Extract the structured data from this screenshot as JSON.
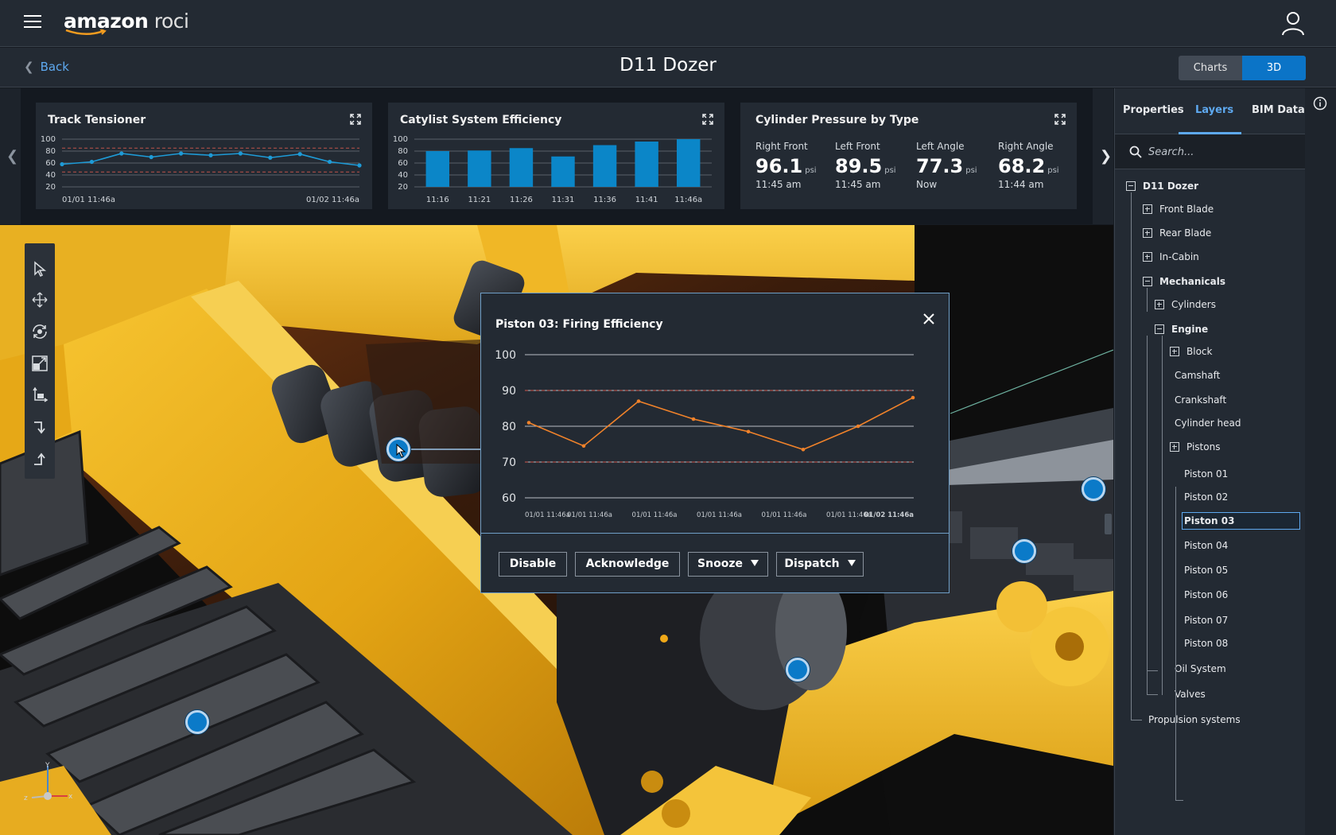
{
  "header": {
    "logo_bold": "amazon",
    "logo_thin": "roci",
    "back_label": "Back",
    "title": "D11 Dozer",
    "view_toggle": [
      "Charts",
      "3D view"
    ],
    "active_view": "3D view"
  },
  "cards": {
    "track_tensioner": {
      "title": "Track Tensioner",
      "chart_data": {
        "type": "line",
        "y_ticks": [
          100,
          80,
          60,
          40,
          20
        ],
        "ylim": [
          20,
          100
        ],
        "x_labels": [
          "01/01 11:46a",
          "01/02 11:46a"
        ],
        "values": [
          58,
          62,
          76,
          70,
          76,
          73,
          76,
          69,
          75,
          62,
          56
        ],
        "thresholds": [
          85,
          45
        ],
        "colors": {
          "line": "#1e9bd7",
          "threshold": "#c0524a",
          "grid": "#58606a"
        }
      }
    },
    "catalyst": {
      "title": "Catylist System Efficiency",
      "chart_data": {
        "type": "bar",
        "categories": [
          "11:16",
          "11:21",
          "11:26",
          "11:31",
          "11:36",
          "11:41",
          "11:46a"
        ],
        "values": [
          80,
          81,
          85,
          71,
          90,
          96,
          100
        ],
        "y_ticks": [
          100,
          80,
          60,
          40,
          20
        ],
        "ylim": [
          20,
          100
        ],
        "colors": {
          "bar": "#0b86c8",
          "grid": "#58606a"
        }
      }
    },
    "cylinder_pressure": {
      "title": "Cylinder Pressure by Type",
      "items": [
        {
          "label": "Right Front",
          "value": "96.1",
          "unit": "psi",
          "time": "11:45 am"
        },
        {
          "label": "Left Front",
          "value": "89.5",
          "unit": "psi",
          "time": "11:45 am"
        },
        {
          "label": "Left Angle",
          "value": "77.3",
          "unit": "psi",
          "time": "Now"
        },
        {
          "label": "Right Angle",
          "value": "68.2",
          "unit": "psi",
          "time": "11:44 am"
        }
      ]
    }
  },
  "popup": {
    "title": "Piston 03: Firing Efficiency",
    "chart_data": {
      "type": "line",
      "y_ticks": [
        100,
        90,
        80,
        70,
        60
      ],
      "ylim": [
        60,
        100
      ],
      "x_labels": [
        "01/01 11:46a",
        "01/01 11:46a",
        "01/01 11:46a",
        "01/01 11:46a",
        "01/01 11:46a",
        "01/01 11:46a",
        "01/02 11:46a"
      ],
      "values": [
        81,
        74.5,
        87,
        82,
        78.5,
        73.5,
        80,
        88
      ],
      "thresholds": [
        90,
        70
      ],
      "colors": {
        "line": "#f0822a",
        "threshold": "#d0584c",
        "grid": "#b9bec4"
      }
    },
    "buttons": [
      "Disable",
      "Acknowledge",
      "Snooze",
      "Dispatch"
    ]
  },
  "right_panel": {
    "tabs": [
      "Properties",
      "Layers",
      "BIM Data"
    ],
    "active_tab": "Layers",
    "search_placeholder": "Search...",
    "tree": [
      {
        "label": "D11 Dozer",
        "level": 0,
        "toggle": "minus",
        "bold": true
      },
      {
        "label": "Front Blade",
        "level": 1,
        "toggle": "plus"
      },
      {
        "label": "Rear Blade",
        "level": 1,
        "toggle": "plus"
      },
      {
        "label": "In-Cabin",
        "level": 1,
        "toggle": "plus"
      },
      {
        "label": "Mechanicals",
        "level": 1,
        "toggle": "minus",
        "bold": true
      },
      {
        "label": "Cylinders",
        "level": 2,
        "toggle": "plus"
      },
      {
        "label": "Engine",
        "level": 2,
        "toggle": "minus",
        "bold": true
      },
      {
        "label": "Block",
        "level": 3,
        "toggle": "plus"
      },
      {
        "label": "Camshaft",
        "level": 3
      },
      {
        "label": "Crankshaft",
        "level": 3
      },
      {
        "label": "Cylinder head",
        "level": 3
      },
      {
        "label": "Pistons",
        "level": 3,
        "toggle": "plus"
      },
      {
        "label": "Piston 01",
        "level": 4
      },
      {
        "label": "Piston 02",
        "level": 4
      },
      {
        "label": "Piston 03",
        "level": 4,
        "selected": true,
        "bold": true
      },
      {
        "label": "Piston 04",
        "level": 4
      },
      {
        "label": "Piston 05",
        "level": 4
      },
      {
        "label": "Piston 06",
        "level": 4
      },
      {
        "label": "Piston 07",
        "level": 4
      },
      {
        "label": "Piston 08",
        "level": 4
      },
      {
        "label": "Oil System",
        "level": 3
      },
      {
        "label": "Valves",
        "level": 3
      },
      {
        "label": "Propulsion systems",
        "level": 1
      }
    ]
  },
  "axis_gizmo": {
    "x": "x",
    "y": "Y",
    "z": "z"
  },
  "icons": [
    "menu-icon",
    "user-icon",
    "chevron-left-icon",
    "expand-icon",
    "select-icon",
    "pan-icon",
    "orbit-icon",
    "zoom-extents-icon",
    "move-icon",
    "step-down-icon",
    "step-up-icon",
    "close-icon",
    "search-icon",
    "info-icon"
  ]
}
